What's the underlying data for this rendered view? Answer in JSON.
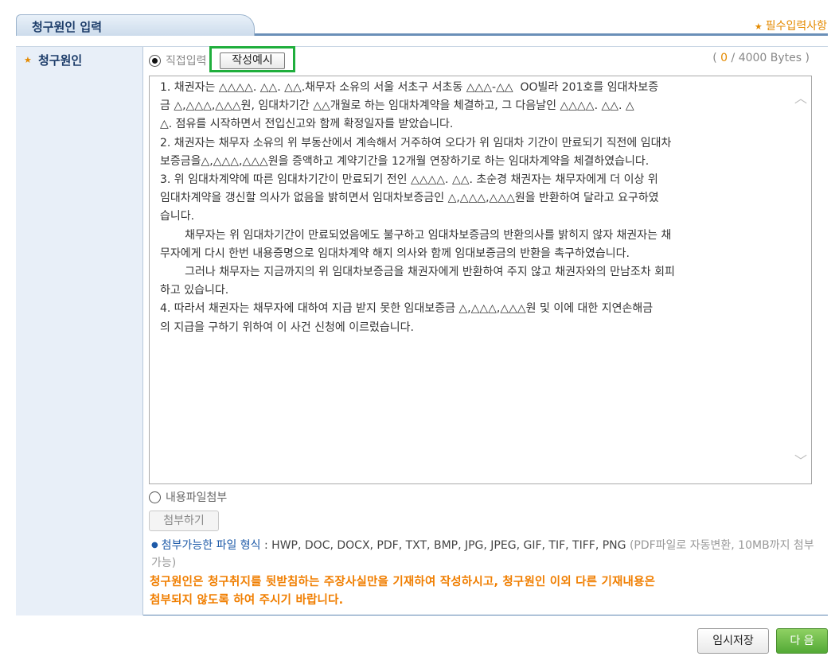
{
  "header": {
    "title": "청구원인 입력",
    "required_note": "필수입력사항"
  },
  "form": {
    "field_label": "청구원인",
    "direct_input_label": "직접입력",
    "direct_input_selected": true,
    "example_button": "작성예시",
    "bytes": {
      "open": "(",
      "current": "0",
      "rest": "/ 4000 Bytes )"
    },
    "textarea_text": "1. 채권자는 △△△△. △△. △△.채무자 소유의 서울 서초구 서초동 △△△-△△  OO빌라 201호를 임대차보증\n금 △,△△△,△△△원, 임대차기간 △△개월로 하는 임대차계약을 체결하고, 그 다음날인 △△△△. △△. △\n△. 점유를 시작하면서 전입신고와 함께 확정일자를 받았습니다.\n2. 채권자는 채무자 소유의 위 부동산에서 계속해서 거주하여 오다가 위 임대차 기간이 만료되기 직전에 임대차\n보증금을△,△△△,△△△원을 증액하고 계약기간을 12개월 연장하기로 하는 임대차계약을 체결하였습니다.\n3. 위 임대차계약에 따른 임대차기간이 만료되기 전인 △△△△. △△. 초순경 채권자는 채무자에게 더 이상 위\n임대차계약을 갱신할 의사가 없음을 밝히면서 임대차보증금인 △,△△△,△△△원을 반환하여 달라고 요구하였\n습니다.\n       채무자는 위 임대차기간이 만료되었음에도 불구하고 임대차보증금의 반환의사를 밝히지 않자 채권자는 채\n무자에게 다시 한번 내용증명으로 임대차계약 해지 의사와 함께 임대보증금의 반환을 촉구하였습니다.\n       그러나 채무자는 지금까지의 위 임대차보증금을 채권자에게 반환하여 주지 않고 채권자와의 만남조차 회피\n하고 있습니다.\n4. 따라서 채권자는 채무자에 대하여 지급 받지 못한 임대보증금 △,△△△,△△△원 및 이에 대한 지연손해금\n의 지급을 구하기 위하여 이 사건 신청에 이르렀습니다.",
    "file_attach_label": "내용파일첨부",
    "attach_button": "첨부하기",
    "file_types_title": "첨부가능한 파일 형식",
    "file_types": " : HWP, DOC, DOCX, PDF, TXT, BMP, JPG, JPEG, GIF, TIF, TIFF, PNG ",
    "file_types_note": "(PDF파일로 자동변환, 10MB까지 첨부가능)",
    "warning_line1": "청구원인은 청구취지를 뒷받침하는 주장사실만을 기재하여 작성하시고, 청구원인 이외 다른 기재내용은",
    "warning_line2": "첨부되지 않도록 하여 주시기 바랍니다."
  },
  "buttons": {
    "temp_save": "임시저장",
    "next": "다 음"
  },
  "colors": {
    "accent_orange": "#e48a00",
    "header_blue": "#1d3d6a",
    "highlight_green": "#1fae3c",
    "next_green": "#53a936"
  }
}
